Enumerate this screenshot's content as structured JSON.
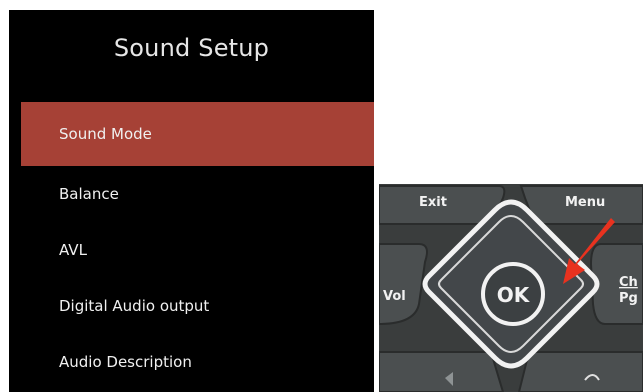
{
  "menu": {
    "title": "Sound Setup",
    "items": [
      {
        "label": "Sound Mode",
        "selected": true
      },
      {
        "label": "Balance",
        "selected": false
      },
      {
        "label": "AVL",
        "selected": false
      },
      {
        "label": "Digital Audio output",
        "selected": false
      },
      {
        "label": "Audio Description",
        "selected": false
      }
    ]
  },
  "remote": {
    "exit_label": "Exit",
    "menu_label": "Menu",
    "vol_label": "Vol",
    "ok_label": "OK",
    "ch_label": "Ch",
    "pg_label": "Pg",
    "colors": {
      "body": "#3a3d3d",
      "button": "#4b4f50",
      "outline": "#f2f2f2",
      "arrow": "#e8321f"
    }
  },
  "colors": {
    "selected_bg": "#a64136",
    "panel_bg": "#000000"
  }
}
